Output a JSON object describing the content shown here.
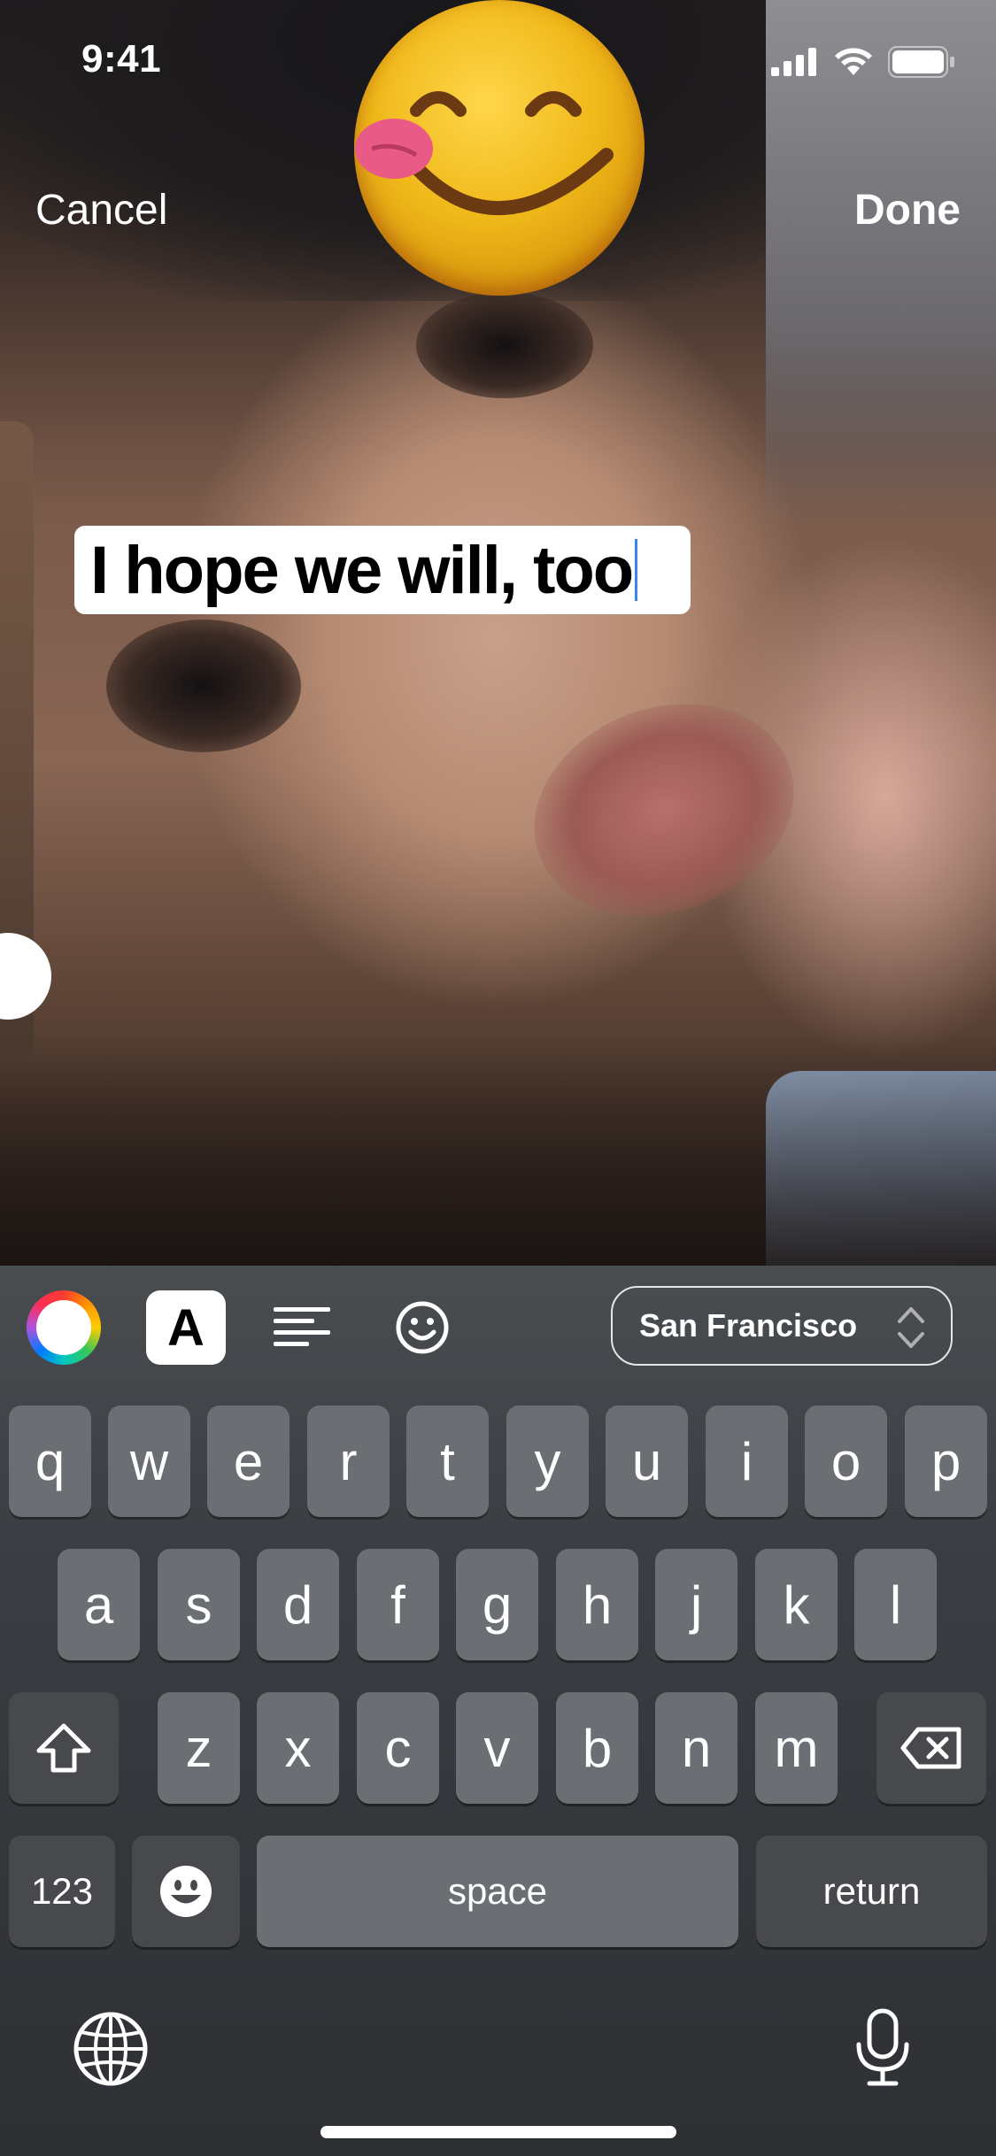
{
  "status_bar": {
    "time": "9:41"
  },
  "editor": {
    "cancel_label": "Cancel",
    "done_label": "Done",
    "text_sticker": "I hope we will, too",
    "emoji_sticker": "😋"
  },
  "toolbar": {
    "text_style_label": "A",
    "font_name": "San Francisco"
  },
  "keyboard": {
    "row1": [
      "q",
      "w",
      "e",
      "r",
      "t",
      "y",
      "u",
      "i",
      "o",
      "p"
    ],
    "row2": [
      "a",
      "s",
      "d",
      "f",
      "g",
      "h",
      "j",
      "k",
      "l"
    ],
    "row3": [
      "z",
      "x",
      "c",
      "v",
      "b",
      "n",
      "m"
    ],
    "numbers_label": "123",
    "space_label": "space",
    "return_label": "return"
  },
  "colors": {
    "accent": "#3b82f6",
    "key_fill": "#6b6e72",
    "function_key_fill": "#48494c"
  }
}
